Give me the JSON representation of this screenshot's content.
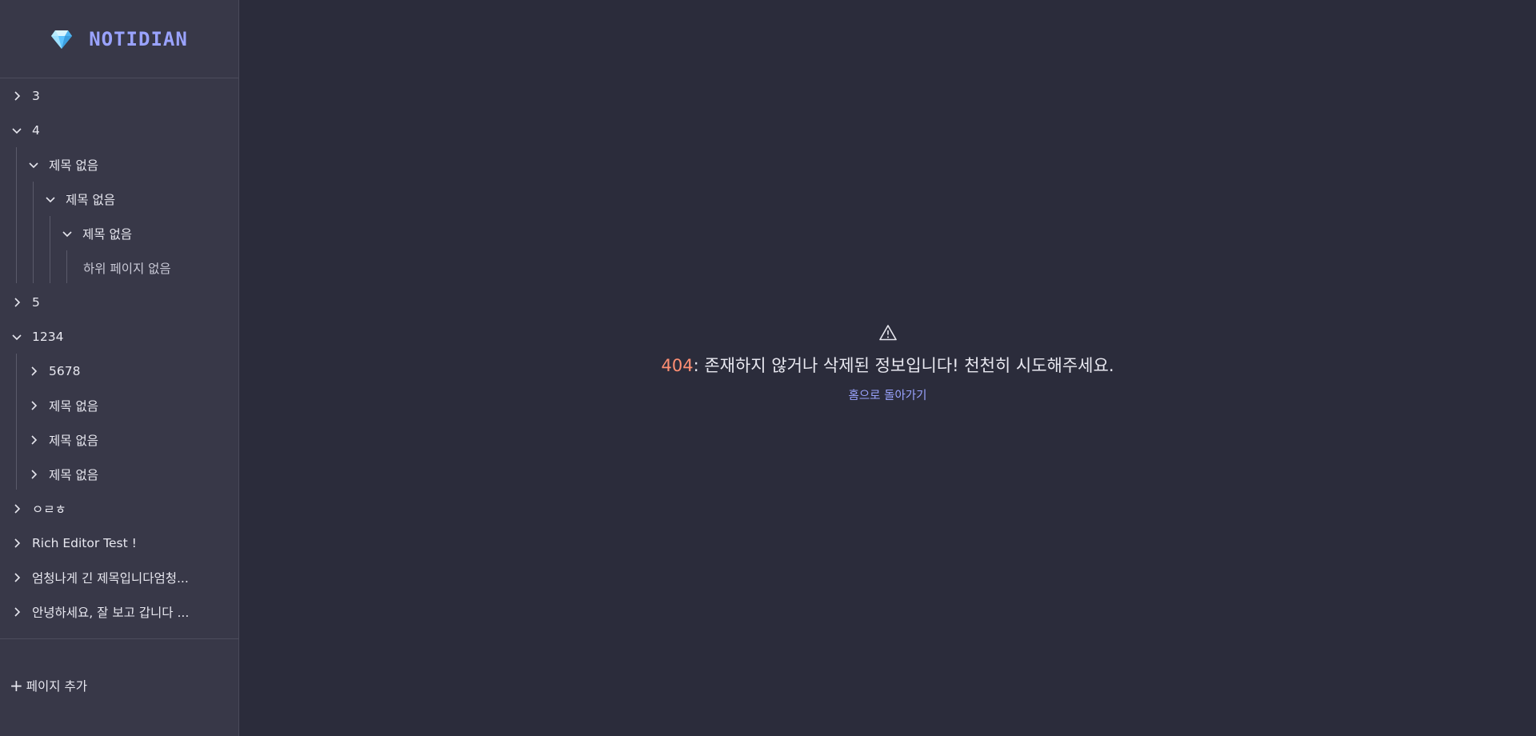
{
  "brand": {
    "name": "NOTIDIAN",
    "icon": "gem-icon",
    "accent": "#9aa3ff"
  },
  "sidebar": {
    "items": [
      {
        "label": "3",
        "state": "collapsed"
      },
      {
        "label": "4",
        "state": "expanded"
      },
      {
        "label": "제목 없음",
        "state": "expanded"
      },
      {
        "label": "제목 없음",
        "state": "expanded"
      },
      {
        "label": "제목 없음",
        "state": "expanded"
      },
      {
        "label": "하위 페이지 없음",
        "state": "empty"
      },
      {
        "label": "5",
        "state": "collapsed"
      },
      {
        "label": "1234",
        "state": "expanded"
      },
      {
        "label": "5678",
        "state": "collapsed"
      },
      {
        "label": "제목 없음",
        "state": "collapsed"
      },
      {
        "label": "제목 없음",
        "state": "collapsed"
      },
      {
        "label": "제목 없음",
        "state": "collapsed"
      },
      {
        "label": "ㅇㄹㅎ",
        "state": "collapsed"
      },
      {
        "label": "Rich Editor Test !",
        "state": "collapsed"
      },
      {
        "label": "엄청나게 긴 제목입니다엄청...",
        "state": "collapsed"
      },
      {
        "label": "안녕하세요, 잘 보고 갑니다 ...",
        "state": "collapsed"
      }
    ],
    "add_page_label": "페이지 추가",
    "add_page_icon": "plus-icon"
  },
  "error": {
    "icon": "warning-icon",
    "code": "404",
    "message": ": 존재하지 않거나 삭제된 정보입니다! 천천히 시도해주세요.",
    "home_link": "홈으로 돌아가기",
    "code_color": "#ff8f73",
    "link_color": "#9aa3ff"
  }
}
